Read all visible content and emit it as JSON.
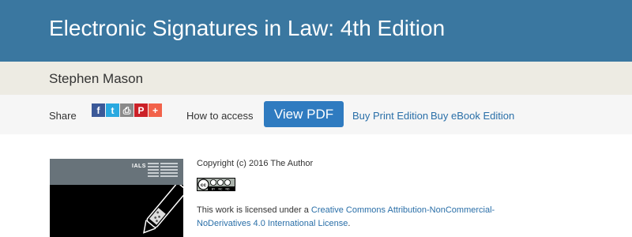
{
  "header": {
    "title": "Electronic Signatures in Law: 4th Edition",
    "color": "#3a77a0"
  },
  "author": {
    "name": "Stephen Mason"
  },
  "actions": {
    "share_label": "Share",
    "social": [
      {
        "icon": "facebook-icon",
        "glyph": "f",
        "color": "#3b5998"
      },
      {
        "icon": "twitter-icon",
        "glyph": "t",
        "color": "#29a9e0"
      },
      {
        "icon": "print-icon",
        "glyph": "⎙",
        "color": "#8a8a8a"
      },
      {
        "icon": "pinterest-icon",
        "glyph": "P",
        "color": "#cb2027"
      },
      {
        "icon": "more-share-icon",
        "glyph": "+",
        "color": "#f2624a"
      }
    ],
    "access_label": "How to access",
    "view_pdf": "View PDF",
    "buy_print": "Buy Print Edition",
    "buy_ebook": "Buy eBook Edition",
    "accent": "#2f7bc0"
  },
  "cover": {
    "publisher": "IALS"
  },
  "license": {
    "copyright": "Copyright (c) 2016 The Author",
    "badge_text": "cc BY NC ND",
    "text_before": "This work is licensed under a ",
    "link_text": "Creative Commons Attribution-NonCommercial-NoDerivatives 4.0 International License",
    "text_after": "."
  }
}
